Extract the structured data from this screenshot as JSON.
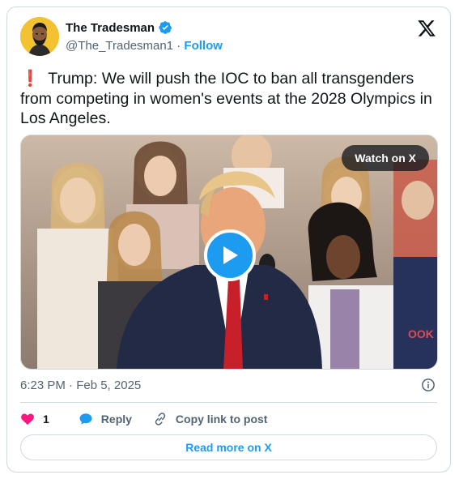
{
  "author": {
    "display_name": "The Tradesman",
    "handle": "@The_Tradesman1",
    "separator": "·",
    "follow_label": "Follow",
    "verified": true
  },
  "tweet": {
    "text": "Trump: We will push the IOC to ban all transgenders from competing in women's events at the 2028 Olympics in Los Angeles.",
    "emoji": "❗"
  },
  "media": {
    "watch_label": "Watch on X"
  },
  "meta": {
    "timestamp": "6:23 PM · Feb 5, 2025"
  },
  "actions": {
    "like_count": "1",
    "reply_label": "Reply",
    "copy_label": "Copy link to post"
  },
  "footer": {
    "read_more_label": "Read more on X"
  },
  "colors": {
    "accent": "#1d9bf0",
    "like": "#f91880",
    "text": "#0f1419",
    "muted": "#536471",
    "border": "#cfd9de"
  }
}
